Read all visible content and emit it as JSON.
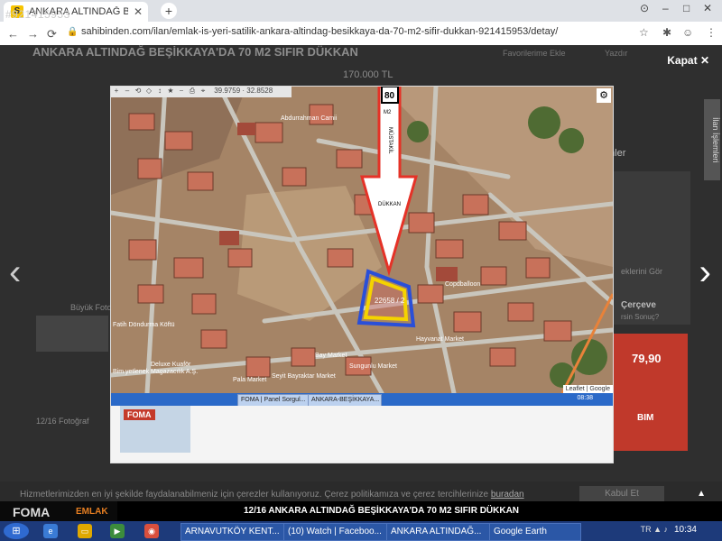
{
  "browser": {
    "tab_title": "ANKARA ALTINDAĞ BEŞİKKAYA'DA",
    "tab_favicon": "S",
    "tab_id_overlay": "#921415953",
    "url": "sahibinden.com/ilan/emlak-is-yeri-satilik-ankara-altindag-besikkaya-da-70-m2-sifir-dukkan-921415953/detay/",
    "nav": {
      "back": "←",
      "forward": "→",
      "reload": "⟳",
      "lock": "🔒"
    },
    "new_tab": "+",
    "window_controls": [
      "–",
      "□",
      "✕"
    ],
    "right_icons": [
      "☆",
      "✱",
      "☺",
      "⋮"
    ]
  },
  "listing": {
    "title": "ANKARA ALTINDAĞ BEŞİKKAYA'DA 70 M2 SIFIR DÜKKAN",
    "price": "170.000 TL",
    "favorites": "Favorilerime Ekle",
    "print": "Yazdır",
    "photo_counter": "12/16 Fotoğraf",
    "big_photo": "Büyük Foto",
    "side_heading": "mler",
    "side_link": "eklerini Gör",
    "side_frame": "Çerçeve",
    "side_frame_sub": "rsin Sonuç?"
  },
  "lightbox": {
    "close": "Kapat",
    "close_icon": "✕",
    "prev_arrow": "‹",
    "next_arrow": "›",
    "caption": "12/16   ANKARA ALTINDAĞ BEŞİKKAYA'DA 70 M2 SIFIR DÜKKAN"
  },
  "map": {
    "tool_icons": [
      "+",
      "–",
      "⟲",
      "◇",
      "↕",
      "★",
      "⎯",
      "⎙",
      "⌖"
    ],
    "coords": "39.9759 · 32.8528",
    "annotation_number": "80",
    "annotation_unit": "M2",
    "annotation_word1": "MÜSTAKİL",
    "annotation_word2": "DÜKKAN",
    "parcel_label": "22658 / 2",
    "labels": [
      "Abdurrahman Camii",
      "Copdballoon",
      "Hayvanat Market",
      "Pala Market",
      "Bim yetlenek Magazacılık A.Ş.",
      "Deluxe Kuaför",
      "Bay Market",
      "Seyit Bayraktar Market",
      "Sungunlu Market",
      "Fatih Döndurma Köftü"
    ],
    "attribution": "Leaflet | Google"
  },
  "inner_taskbar": {
    "items": [
      "FOMA | Panel Sorgul...",
      "ANKARA-BEŞİKKAYA..."
    ],
    "time": "08:38"
  },
  "ad": {
    "price": "79,90",
    "brand": "BIM"
  },
  "cookie": {
    "text": "Hizmetlerimizden en iyi şekilde faydalanabilmeniz için çerezler kullanıyoruz. Çerez politikamıza ve çerez tercihlerinize",
    "link": "buradan",
    "button": "Kabul Et",
    "scroll_top": "▲"
  },
  "brand_logo": {
    "foma": "FOMA",
    "emlak": "EMLAK"
  },
  "taskbar": {
    "items": [
      "ARNAVUTKÖY KENT...",
      "(10) Watch | Faceboo...",
      "ANKARA ALTINDAĞ...",
      "Google Earth"
    ],
    "time": "10:34",
    "tray": "TR  ▲  ♪"
  },
  "colors": {
    "arrow_red": "#e53227",
    "parcel_yellow": "#f5d300",
    "parcel_blue": "#2a4fd8",
    "chrome_bg": "#dee1e6",
    "taskbar_blue": "#1d3a7a"
  }
}
